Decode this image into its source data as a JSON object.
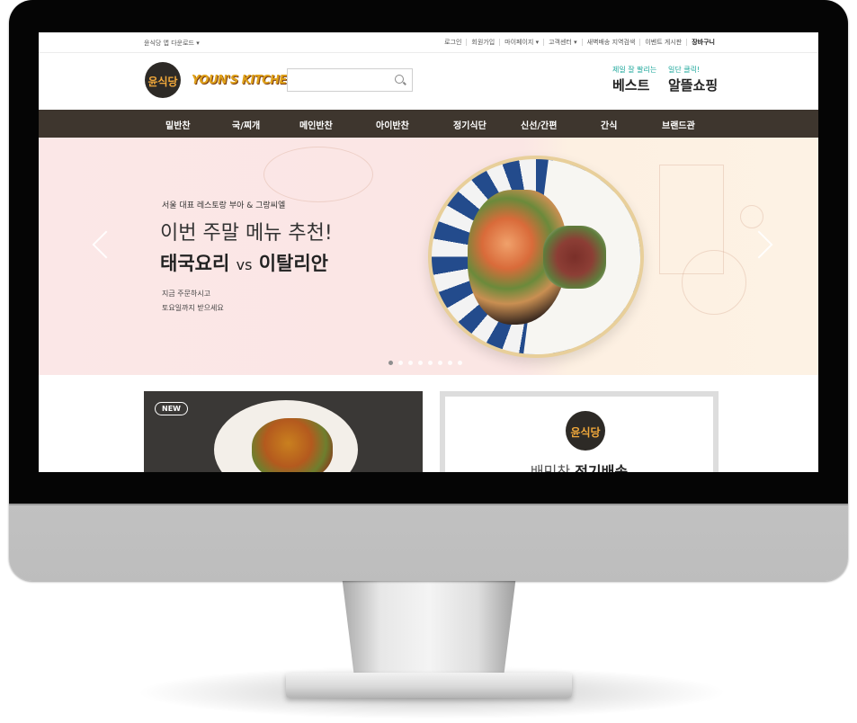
{
  "site": {
    "utility": {
      "app_download": "윤식당 앱 다운로드 ▾",
      "links": [
        "로그인",
        "회원가입",
        "마이페이지 ▾",
        "고객센터 ▾",
        "새벽배송 지역검색",
        "이벤트 게시판",
        "장바구니"
      ]
    },
    "header": {
      "logo_text": "윤식당",
      "brand_text": "YOUN'S KITCHEN",
      "search_placeholder": "",
      "best": {
        "small": "제일 잘 팔리는",
        "big": "베스트"
      },
      "sale": {
        "small": "일단 클릭!",
        "big": "알뜰쇼핑"
      }
    },
    "nav": [
      "밑반찬",
      "국/찌개",
      "메인반찬",
      "아이반찬",
      "정기식단",
      "신선/간편",
      "간식",
      "브랜드관"
    ],
    "hero": {
      "sub": "서울 대표 레스토랑 부아 & 그랑씨엘",
      "line1": "이번 주말 메뉴 추천!",
      "line2_a": "태국요리",
      "line2_vs": "vs",
      "line2_b": "이탈리안",
      "desc1": "지금 주문하시고",
      "desc2": "토요일까지 받으세요",
      "slide_count": 8,
      "active_slide": 1
    },
    "cards": {
      "left_badge": "NEW",
      "right_logo": "윤식당",
      "right_caption_a": "배민찬",
      "right_caption_b": "정기배송"
    }
  }
}
